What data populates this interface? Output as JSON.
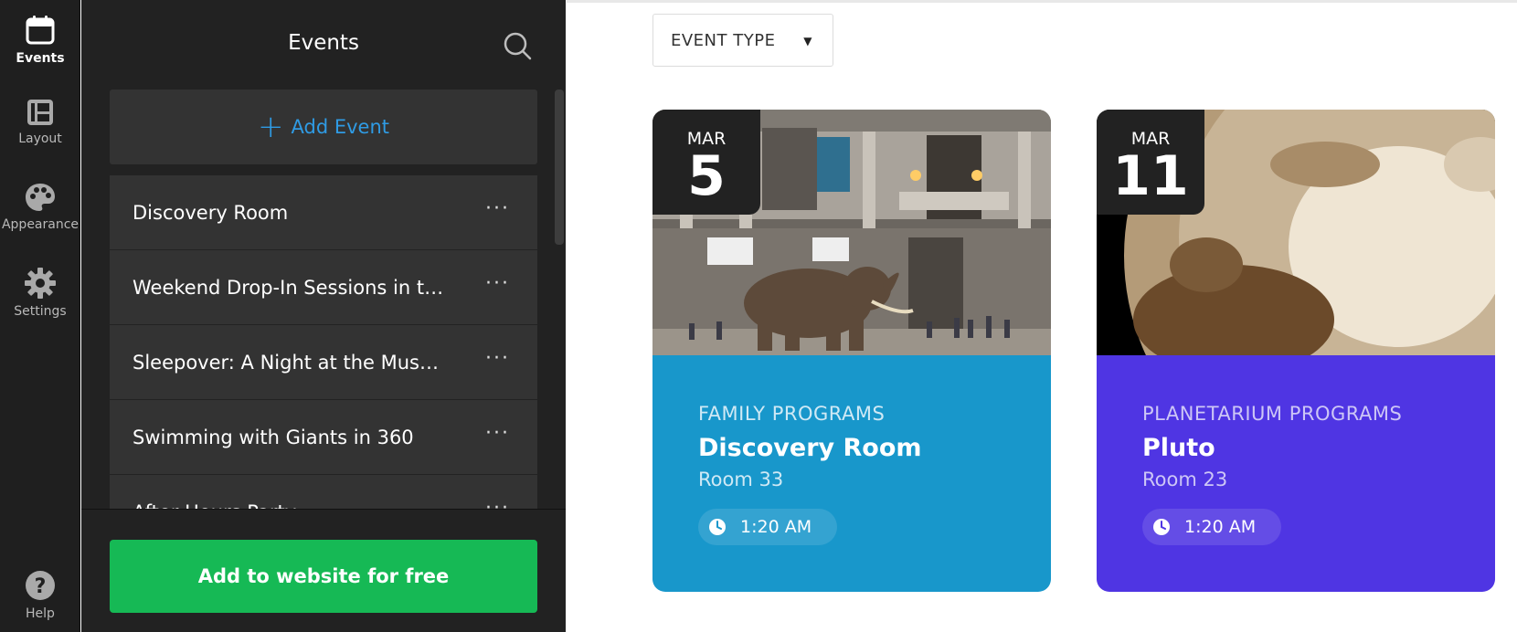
{
  "rail": {
    "items": [
      {
        "label": "Events",
        "icon": "calendar-icon"
      },
      {
        "label": "Layout",
        "icon": "layout-icon"
      },
      {
        "label": "Appearance",
        "icon": "palette-icon"
      },
      {
        "label": "Settings",
        "icon": "gear-icon"
      }
    ],
    "help": {
      "label": "Help",
      "icon": "help-icon"
    }
  },
  "panel": {
    "title": "Events",
    "add_label": "Add Event",
    "events": [
      "Discovery Room",
      "Weekend Drop-In Sessions in the ...",
      "Sleepover: A Night at the Museum",
      "Swimming with Giants in 360",
      "After Hours Party"
    ],
    "more_glyph": "···",
    "cta_label": "Add to website for free"
  },
  "main": {
    "filter_label": "EVENT TYPE",
    "cards": [
      {
        "month": "MAR",
        "day": "5",
        "category": "FAMILY PROGRAMS",
        "name": "Discovery Room",
        "room": "Room 33",
        "time": "1:20 AM",
        "color": "#1897cb"
      },
      {
        "month": "MAR",
        "day": "11",
        "category": "PLANETARIUM PROGRAMS",
        "name": "Pluto",
        "room": "Room 23",
        "time": "1:20 AM",
        "color": "#4f35e3"
      }
    ]
  },
  "colors": {
    "accent_blue": "#2f9be4",
    "cta_green": "#16b955",
    "panel_bg": "#222222",
    "rail_bg": "#1f1f1f"
  }
}
